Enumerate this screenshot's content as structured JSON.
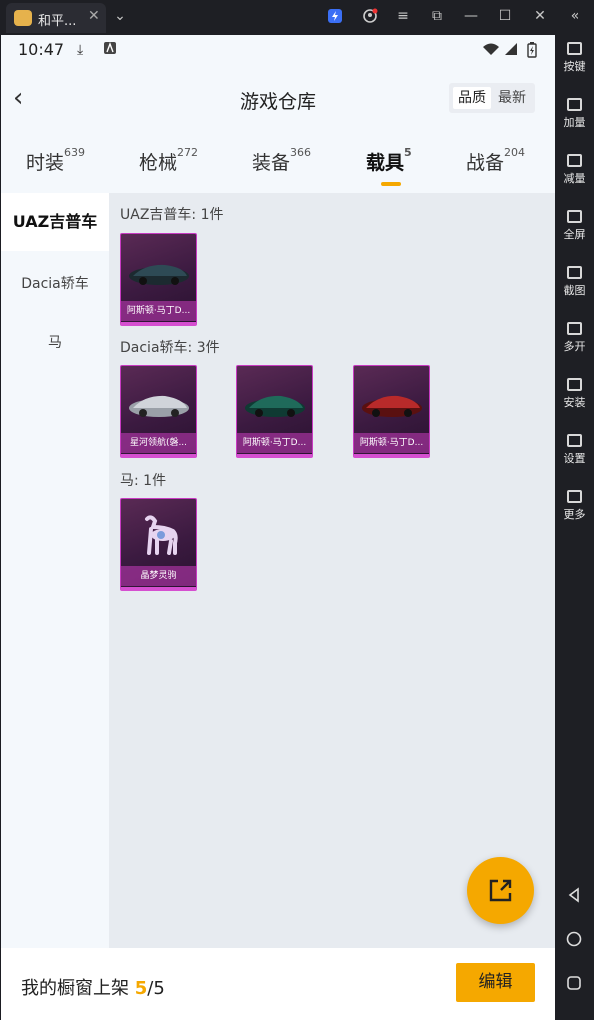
{
  "emulator": {
    "tab_title": "和平...",
    "tab_close": "✕",
    "sidebar": [
      {
        "label": "按键",
        "icon": "keyboard-icon"
      },
      {
        "label": "加量",
        "icon": "volume-up-icon"
      },
      {
        "label": "减量",
        "icon": "volume-down-icon"
      },
      {
        "label": "全屏",
        "icon": "fullscreen-icon"
      },
      {
        "label": "截图",
        "icon": "scissors-icon"
      },
      {
        "label": "多开",
        "icon": "multi-instance-icon"
      },
      {
        "label": "安装",
        "icon": "apk-install-icon"
      },
      {
        "label": "设置",
        "icon": "settings-icon"
      },
      {
        "label": "更多",
        "icon": "more-icon"
      }
    ]
  },
  "status_bar": {
    "time": "10:47"
  },
  "header": {
    "title": "游戏仓库",
    "back_icon": "‹",
    "sort": [
      "品质",
      "最新"
    ]
  },
  "categories": [
    {
      "label": "时装",
      "count": "639"
    },
    {
      "label": "枪械",
      "count": "272"
    },
    {
      "label": "装备",
      "count": "366"
    },
    {
      "label": "载具",
      "count": "5"
    },
    {
      "label": "战备",
      "count": "204"
    }
  ],
  "left_nav": [
    "UAZ吉普车",
    "Dacia轿车",
    "马"
  ],
  "groups": [
    {
      "label": "UAZ吉普车: 1件",
      "items": [
        {
          "name": "阿斯顿·马丁D..."
        }
      ]
    },
    {
      "label": "Dacia轿车: 3件",
      "items": [
        {
          "name": "星河领航(磐..."
        },
        {
          "name": "阿斯顿·马丁D..."
        },
        {
          "name": "阿斯顿·马丁D..."
        }
      ]
    },
    {
      "label": "马: 1件",
      "items": [
        {
          "name": "晶梦灵驹"
        }
      ]
    }
  ],
  "bottom": {
    "label": "我的橱窗上架",
    "count": "5",
    "total": "/5",
    "edit": "编辑"
  },
  "colors": {
    "accent": "#f5a800",
    "card_border": "#d54fd0"
  }
}
